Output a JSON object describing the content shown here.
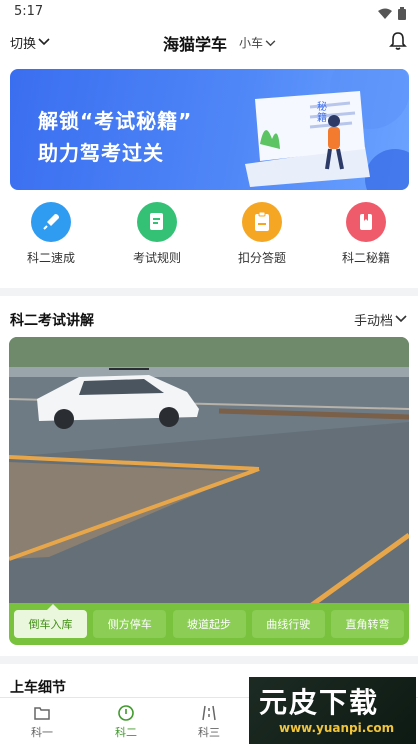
{
  "status_bar": {
    "time": "5:17",
    "wifi_icon": "wifi-icon",
    "battery_icon": "battery-icon"
  },
  "header": {
    "switch_label": "切换",
    "title": "海猫学车",
    "car_type": "小车",
    "bell_icon": "bell-icon"
  },
  "banner": {
    "line1": "解锁“考试秘籍”",
    "line2": "助力驾考过关",
    "book_text": "秘籍"
  },
  "quick_actions": [
    {
      "label": "科二速成",
      "icon": "rocket-icon",
      "color": "#2f9cf1"
    },
    {
      "label": "考试规则",
      "icon": "document-icon",
      "color": "#34c176"
    },
    {
      "label": "扣分答题",
      "icon": "clipboard-icon",
      "color": "#f5a623"
    },
    {
      "label": "科二秘籍",
      "icon": "book-icon",
      "color": "#ef5b6b"
    }
  ],
  "exam_section": {
    "title": "科二考试讲解",
    "gear_label": "手动档",
    "tabs": [
      {
        "label": "倒车入库",
        "active": true
      },
      {
        "label": "侧方停车",
        "active": false
      },
      {
        "label": "坡道起步",
        "active": false
      },
      {
        "label": "曲线行驶",
        "active": false
      },
      {
        "label": "直角转弯",
        "active": false
      }
    ]
  },
  "detail_section": {
    "title": "上车细节"
  },
  "bottom_nav": [
    {
      "label": "科一",
      "icon": "folder-icon",
      "active": false
    },
    {
      "label": "科二",
      "icon": "steering-icon",
      "active": true
    },
    {
      "label": "科三",
      "icon": "road-icon",
      "active": false
    }
  ],
  "watermark": {
    "text": "元皮下载",
    "url": "www.yuanpi.com"
  },
  "colors": {
    "accent_green": "#79c23e",
    "banner_blue": "#3a6ef0"
  }
}
